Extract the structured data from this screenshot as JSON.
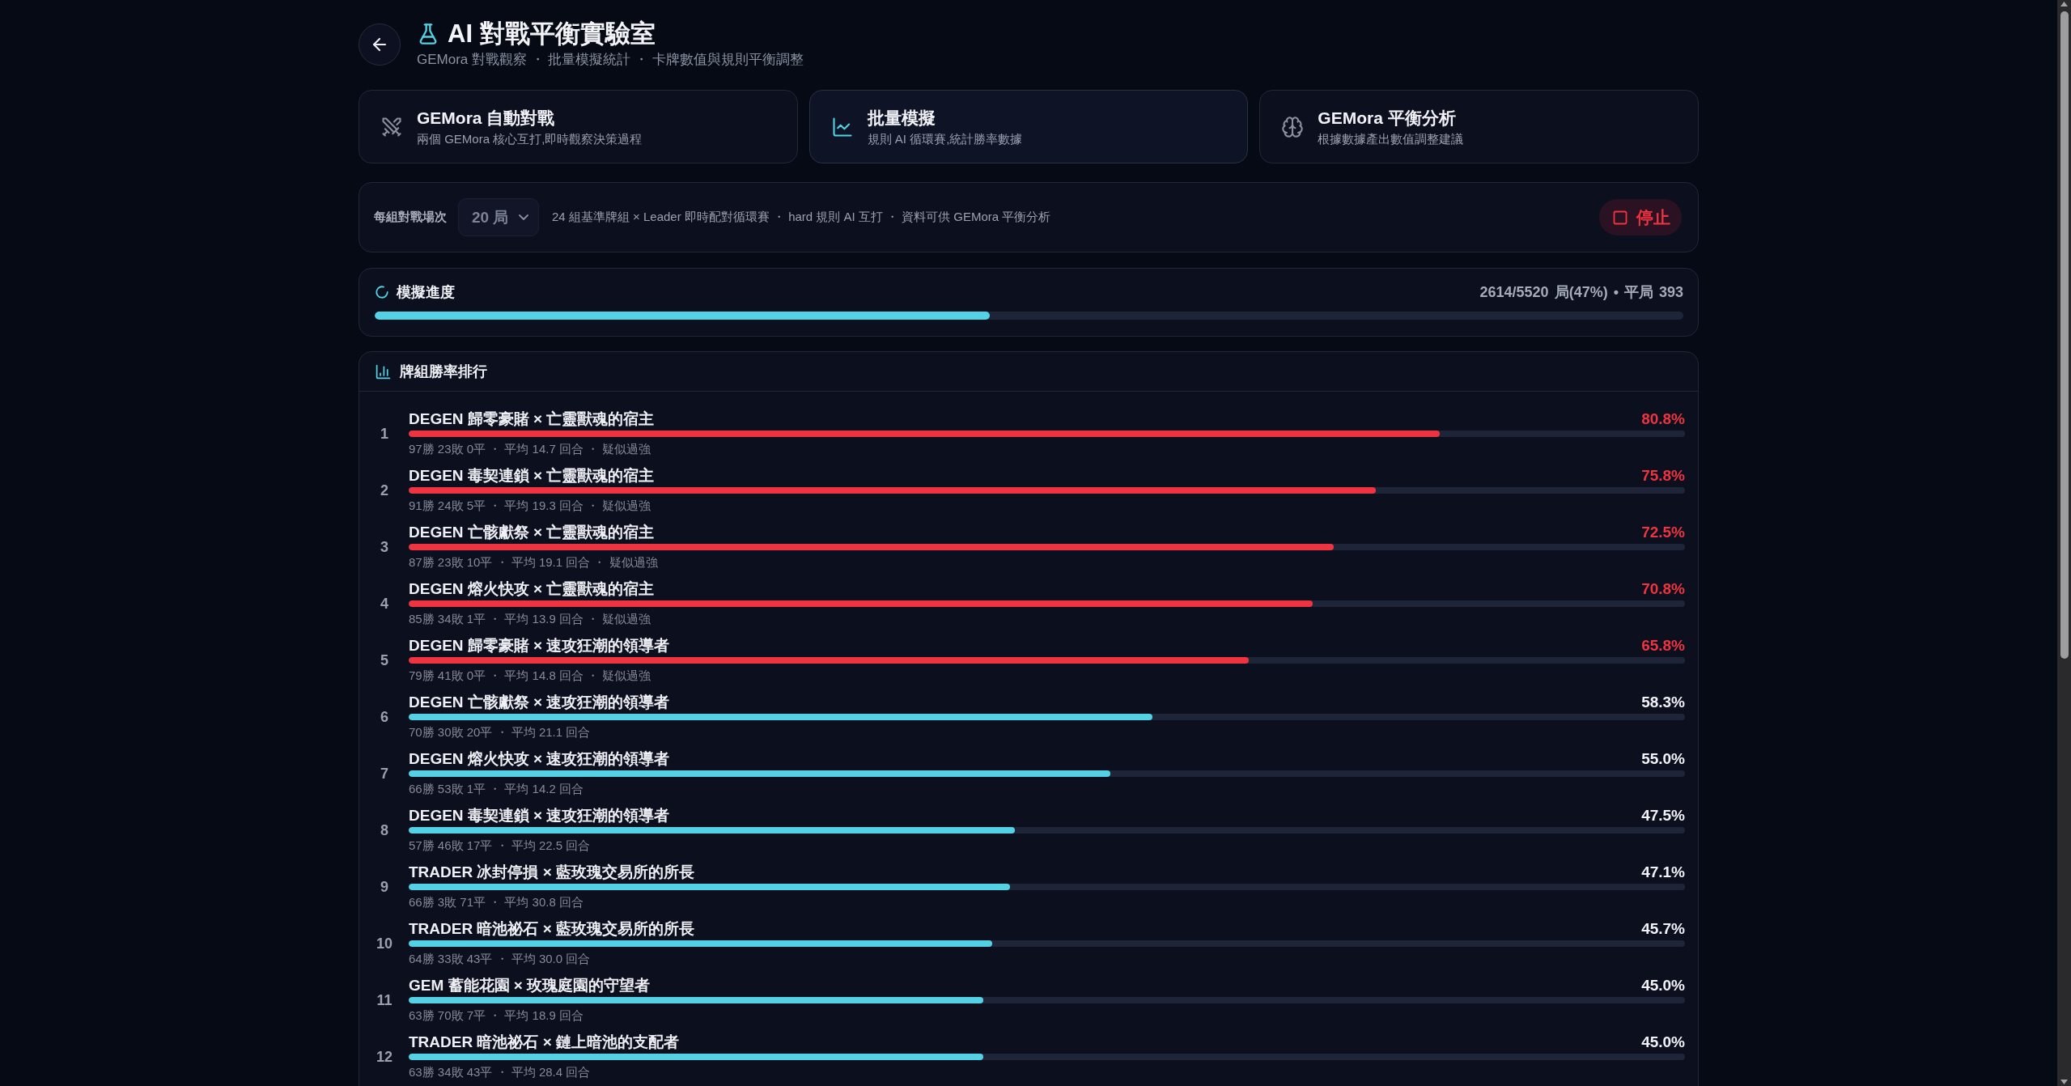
{
  "header": {
    "title": "AI 對戰平衡實驗室",
    "subtitle": "GEMora 對戰觀察 ・ 批量模擬統計 ・ 卡牌數值與規則平衡調整"
  },
  "modes": [
    {
      "title": "GEMora 自動對戰",
      "description": "兩個 GEMora 核心互打,即時觀察決策過程",
      "selected": false
    },
    {
      "title": "批量模擬",
      "description": "規則 AI 循環賽,統計勝率數據",
      "selected": true
    },
    {
      "title": "GEMora 平衡分析",
      "description": "根據數據產出數值調整建議",
      "selected": false
    }
  ],
  "controls": {
    "label": "每組對戰場次",
    "select": {
      "value": "20 局"
    },
    "description": "24 組基準牌組 × Leader 即時配對循環賽 ・ hard 規則 AI 互打 ・ 資料可供 GEMora 平衡分析",
    "stop_button": "停止"
  },
  "progress": {
    "title": "模擬進度",
    "reading": "2614/5520 局(47%) • 平局 393",
    "level": 0.47
  },
  "ranking": {
    "title": "牌組勝率排行",
    "rows": [
      {
        "rank": "1",
        "name": "DEGEN 歸零豪賭 × 亡靈獸魂的宿主",
        "win_rate": "80.8%",
        "level": 0.808,
        "flagged": true,
        "stats": "97勝 23敗 0平 ・ 平均 14.7 回合 ・ 疑似過強"
      },
      {
        "rank": "2",
        "name": "DEGEN 毒契連鎖 × 亡靈獸魂的宿主",
        "win_rate": "75.8%",
        "level": 0.758,
        "flagged": true,
        "stats": "91勝 24敗 5平 ・ 平均 19.3 回合 ・ 疑似過強"
      },
      {
        "rank": "3",
        "name": "DEGEN 亡骸獻祭 × 亡靈獸魂的宿主",
        "win_rate": "72.5%",
        "level": 0.725,
        "flagged": true,
        "stats": "87勝 23敗 10平 ・ 平均 19.1 回合 ・ 疑似過強"
      },
      {
        "rank": "4",
        "name": "DEGEN 熔火快攻 × 亡靈獸魂的宿主",
        "win_rate": "70.8%",
        "level": 0.708,
        "flagged": true,
        "stats": "85勝 34敗 1平 ・ 平均 13.9 回合 ・ 疑似過強"
      },
      {
        "rank": "5",
        "name": "DEGEN 歸零豪賭 × 速攻狂潮的領導者",
        "win_rate": "65.8%",
        "level": 0.658,
        "flagged": true,
        "stats": "79勝 41敗 0平 ・ 平均 14.8 回合 ・ 疑似過強"
      },
      {
        "rank": "6",
        "name": "DEGEN 亡骸獻祭 × 速攻狂潮的領導者",
        "win_rate": "58.3%",
        "level": 0.583,
        "flagged": false,
        "stats": "70勝 30敗 20平 ・ 平均 21.1 回合"
      },
      {
        "rank": "7",
        "name": "DEGEN 熔火快攻 × 速攻狂潮的領導者",
        "win_rate": "55.0%",
        "level": 0.55,
        "flagged": false,
        "stats": "66勝 53敗 1平 ・ 平均 14.2 回合"
      },
      {
        "rank": "8",
        "name": "DEGEN 毒契連鎖 × 速攻狂潮的領導者",
        "win_rate": "47.5%",
        "level": 0.475,
        "flagged": false,
        "stats": "57勝 46敗 17平 ・ 平均 22.5 回合"
      },
      {
        "rank": "9",
        "name": "TRADER 冰封停損 × 藍玫瑰交易所的所長",
        "win_rate": "47.1%",
        "level": 0.471,
        "flagged": false,
        "stats": "66勝 3敗 71平 ・ 平均 30.8 回合"
      },
      {
        "rank": "10",
        "name": "TRADER 暗池祕石 × 藍玫瑰交易所的所長",
        "win_rate": "45.7%",
        "level": 0.457,
        "flagged": false,
        "stats": "64勝 33敗 43平 ・ 平均 30.0 回合"
      },
      {
        "rank": "11",
        "name": "GEM 蓄能花園 × 玫瑰庭園的守望者",
        "win_rate": "45.0%",
        "level": 0.45,
        "flagged": false,
        "stats": "63勝 70敗 7平 ・ 平均 18.9 回合"
      },
      {
        "rank": "12",
        "name": "TRADER 暗池祕石 × 鏈上暗池的支配者",
        "win_rate": "45.0%",
        "level": 0.45,
        "flagged": false,
        "stats": "63勝 34敗 43平 ・ 平均 28.4 回合"
      }
    ]
  }
}
